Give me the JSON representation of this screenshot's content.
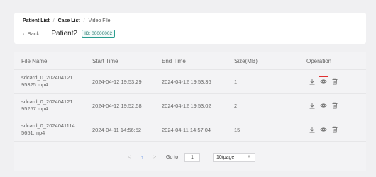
{
  "breadcrumb": {
    "items": [
      "Patient List",
      "Case List",
      "Video File"
    ],
    "separator": "/"
  },
  "header": {
    "back_label": "Back",
    "patient_name": "Patient2",
    "id_tag": "ID: 00000002"
  },
  "table": {
    "columns": [
      "File Name",
      "Start Time",
      "End Time",
      "Size(MB)",
      "Operation"
    ],
    "rows": [
      {
        "file_line1": "sdcard_0_202404121",
        "file_line2": "95325.mp4",
        "start": "2024-04-12 19:53:29",
        "end": "2024-04-12 19:53:36",
        "size": "1"
      },
      {
        "file_line1": "sdcard_0_202404121",
        "file_line2": "95257.mp4",
        "start": "2024-04-12 19:52:58",
        "end": "2024-04-12 19:53:02",
        "size": "2"
      },
      {
        "file_line1": "sdcard_0_2024041114",
        "file_line2": "5651.mp4",
        "start": "2024-04-11 14:56:52",
        "end": "2024-04-11 14:57:04",
        "size": "15"
      }
    ]
  },
  "pagination": {
    "prev": "<",
    "current_page": "1",
    "next": ">",
    "goto_label": "Go to",
    "goto_value": "1",
    "page_size": "10/page"
  },
  "icons": {
    "download": "download-icon",
    "preview": "eye-icon",
    "delete": "trash-icon"
  },
  "colors": {
    "accent": "#2f6fe0",
    "id_tag": "#2a9d8f",
    "highlight": "#e03131"
  }
}
